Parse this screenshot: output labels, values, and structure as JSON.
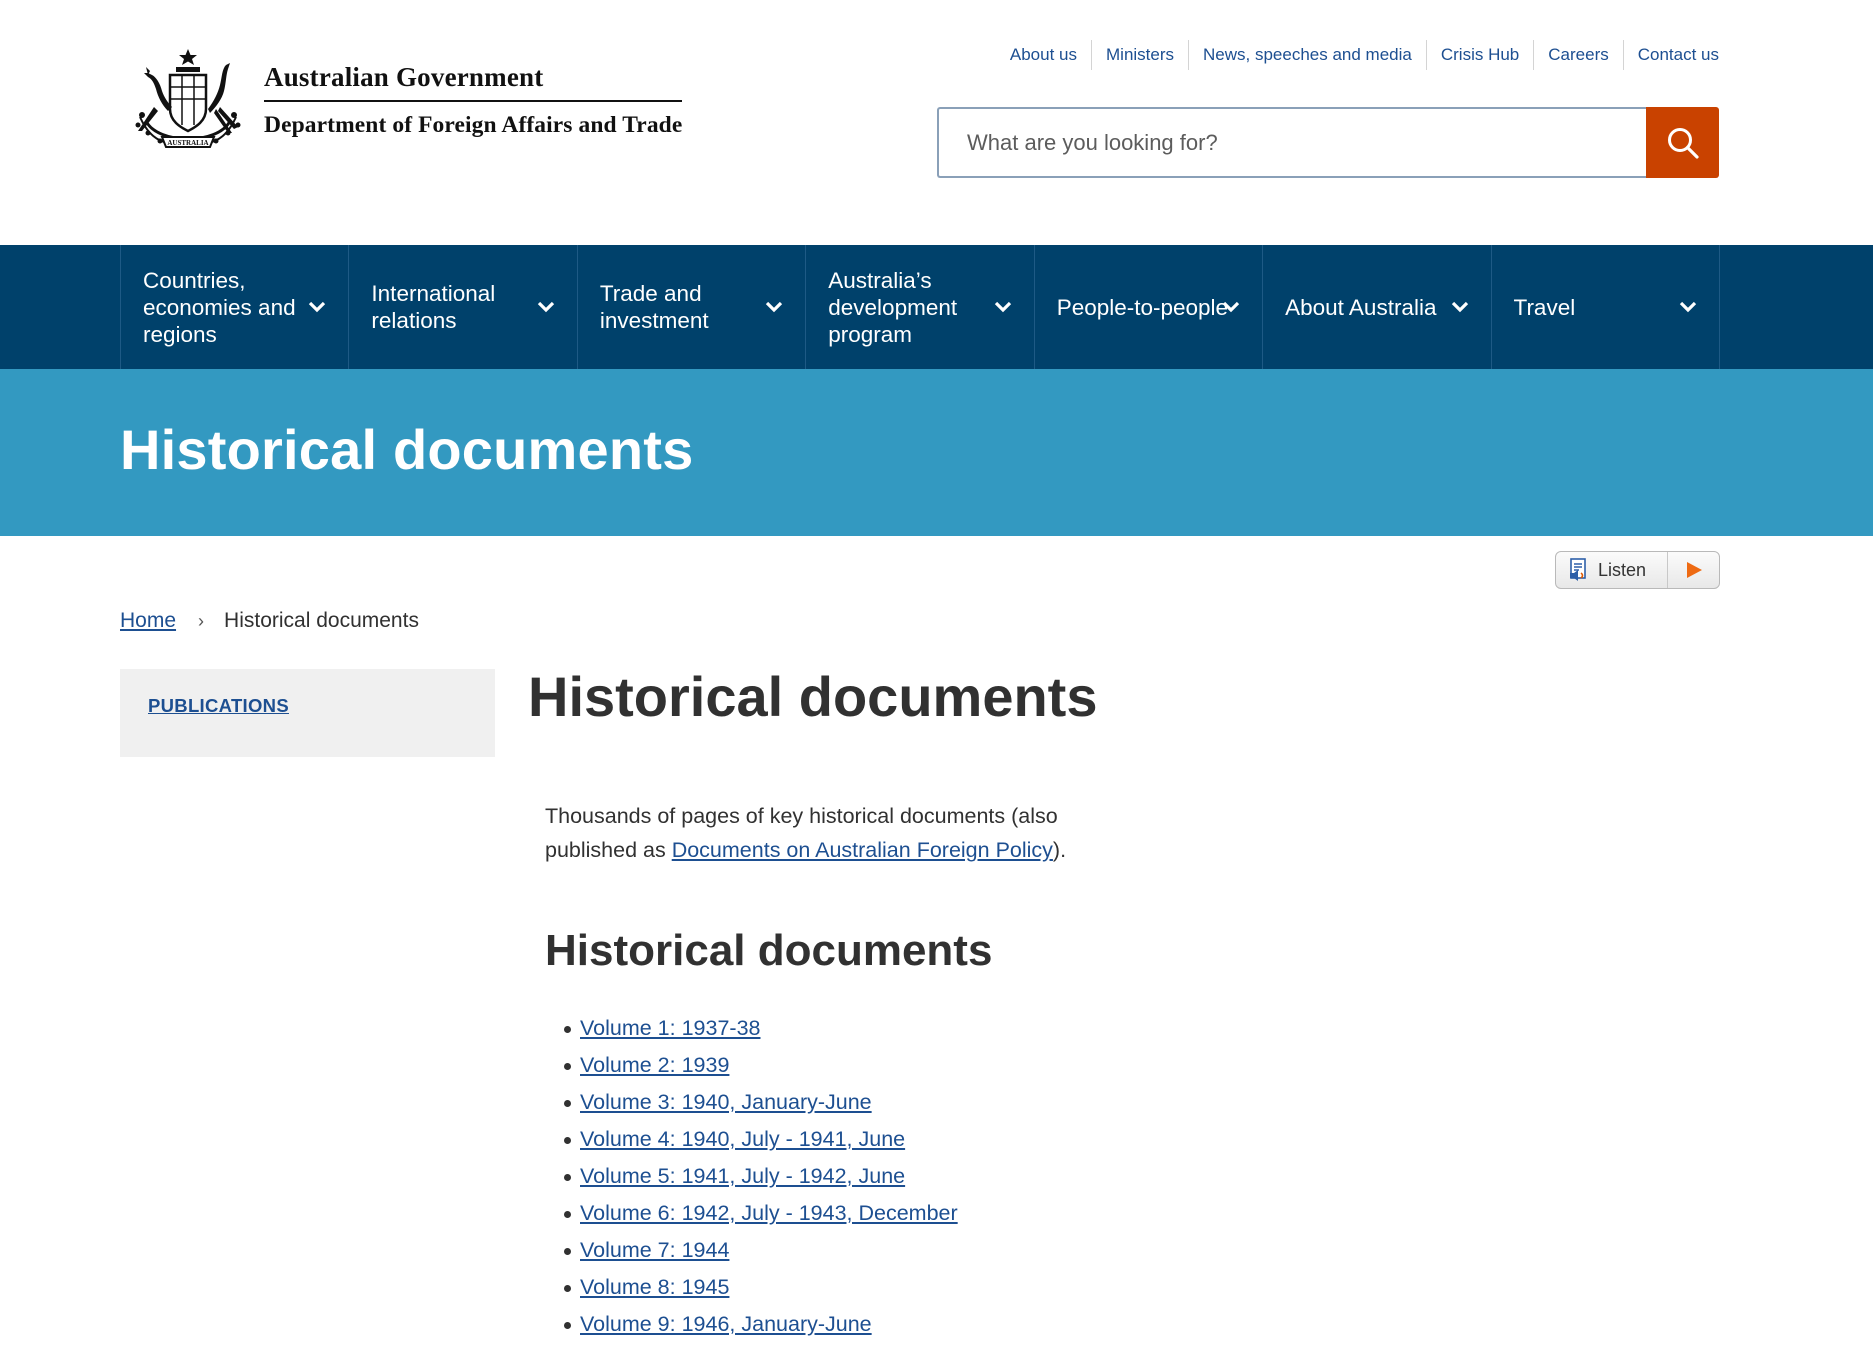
{
  "header": {
    "logo_line1": "Australian Government",
    "logo_line2": "Department of Foreign Affairs and Trade",
    "utility_links": [
      {
        "label": "About us"
      },
      {
        "label": "Ministers"
      },
      {
        "label": "News, speeches and media"
      },
      {
        "label": "Crisis Hub"
      },
      {
        "label": "Careers"
      },
      {
        "label": "Contact us"
      }
    ],
    "search": {
      "placeholder": "What are you looking for?",
      "value": "",
      "button_icon": "search-icon",
      "button_color": "#c94200"
    }
  },
  "main_nav": {
    "background": "#00416b",
    "items": [
      {
        "label": "Countries, economies and regions"
      },
      {
        "label": "International relations"
      },
      {
        "label": "Trade and investment"
      },
      {
        "label": "Australia’s development program"
      },
      {
        "label": "People-to-people"
      },
      {
        "label": "About Australia"
      },
      {
        "label": "Travel"
      }
    ]
  },
  "banner": {
    "title": "Historical documents",
    "background": "#3399c1"
  },
  "listen": {
    "label": "Listen",
    "icon": "speaker-document-icon",
    "play_icon": "play-icon"
  },
  "breadcrumb": {
    "home": "Home",
    "separator": "›",
    "current": "Historical documents"
  },
  "sidebar": {
    "link": "PUBLICATIONS"
  },
  "content": {
    "title": "Historical documents",
    "intro_before": "Thousands of pages of key historical documents (also published as ",
    "intro_link": "Documents on Australian Foreign Policy",
    "intro_after": ").",
    "section_heading": "Historical documents",
    "volumes": [
      {
        "label": "Volume 1: 1937-38"
      },
      {
        "label": "Volume 2: 1939"
      },
      {
        "label": "Volume 3: 1940, January-June"
      },
      {
        "label": "Volume 4: 1940, July - 1941, June"
      },
      {
        "label": "Volume 5: 1941, July - 1942, June"
      },
      {
        "label": "Volume 6: 1942, July - 1943, December"
      },
      {
        "label": "Volume 7: 1944"
      },
      {
        "label": "Volume 8: 1945"
      },
      {
        "label": "Volume 9: 1946, January-June"
      }
    ],
    "link_color": "#1d4f91"
  }
}
